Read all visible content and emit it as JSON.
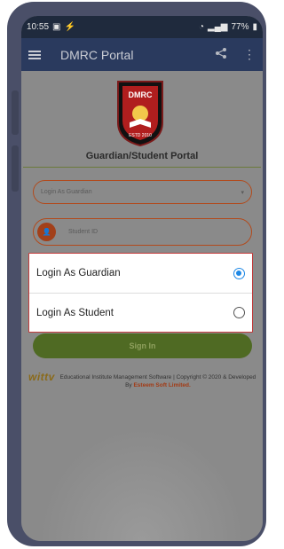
{
  "status_bar": {
    "time": "10:55",
    "battery": "77%"
  },
  "app_bar": {
    "title": "DMRC Portal"
  },
  "logo": {
    "top_text": "DMRC",
    "bottom_text": "ESTD 2010"
  },
  "portal": {
    "title": "Guardian/Student Portal"
  },
  "login_select": {
    "value": "Login As Guardian"
  },
  "student_id": {
    "placeholder": "Student ID"
  },
  "signin_button": {
    "label": "Sign In"
  },
  "footer": {
    "brand": "wittv",
    "text_line": "Educational Institute Management Software | Copyright © 2020 & Developed By",
    "company": "Esteem Soft Limited."
  },
  "dialog": {
    "options": [
      {
        "label": "Login As Guardian",
        "selected": true
      },
      {
        "label": "Login As Student",
        "selected": false
      }
    ]
  },
  "colors": {
    "accent": "#1e88e5",
    "brand_orange": "#b24a1c",
    "signin_green": "#4f6a23",
    "app_bar": "#2a3a5e"
  }
}
